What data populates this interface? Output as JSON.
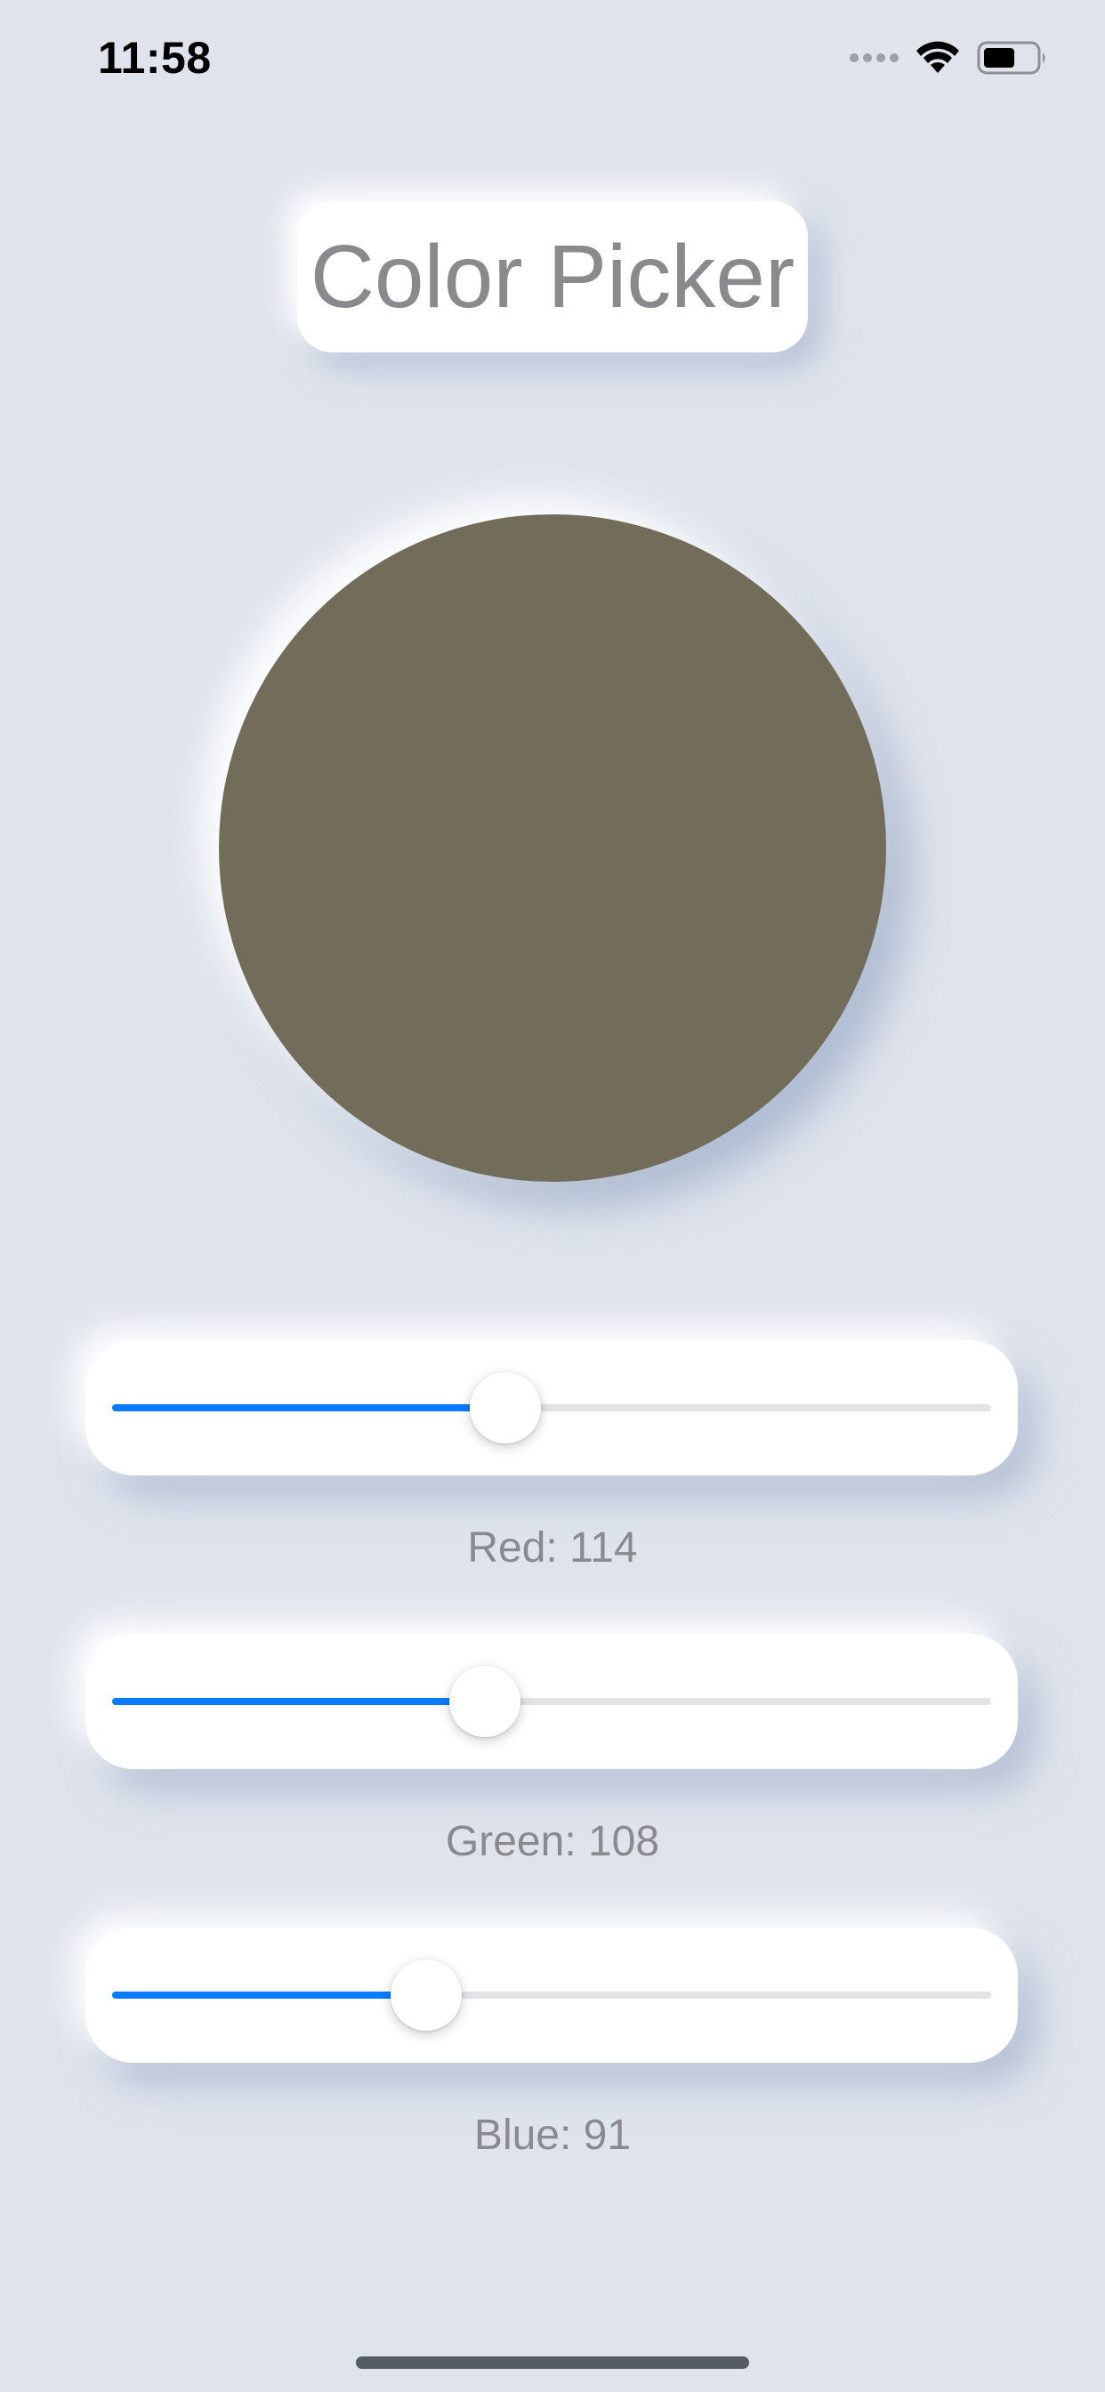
{
  "status_bar": {
    "time": "11:58",
    "icons": [
      "cellular-signal-icon",
      "wifi-icon",
      "battery-icon"
    ]
  },
  "title": "Color Picker",
  "color": {
    "red": 114,
    "green": 108,
    "blue": 91,
    "hex": "#726c5b"
  },
  "sliders": [
    {
      "name": "red",
      "label": "Red: 114",
      "value": 114,
      "max": 255,
      "fraction": 0.447
    },
    {
      "name": "green",
      "label": "Green: 108",
      "value": 108,
      "max": 255,
      "fraction": 0.424
    },
    {
      "name": "blue",
      "label": "Blue: 91",
      "value": 91,
      "max": 255,
      "fraction": 0.357
    }
  ],
  "colors": {
    "background": "#dfe4ec",
    "accent": "#0a7aff",
    "track": "#e3e3e6",
    "label_text": "#8a8a8e"
  }
}
